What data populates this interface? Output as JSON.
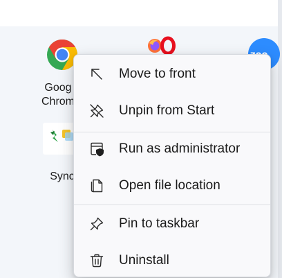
{
  "pinned_apps": {
    "chrome": {
      "label_line1": "Goog",
      "label_line2": "Chrom",
      "icon": "chrome-icon"
    },
    "opera_firefox": {
      "icon": "firefox-opera-icons"
    },
    "zoom": {
      "icon": "zoom-icon",
      "text": "zoo"
    },
    "sync": {
      "label": "Sync",
      "icon": "sync-app-icon"
    }
  },
  "context_menu": {
    "items": [
      {
        "label": "Move to front",
        "icon": "arrow-up-left-icon"
      },
      {
        "label": "Unpin from Start",
        "icon": "unpin-icon"
      },
      {
        "label": "Run as administrator",
        "icon": "shield-window-icon"
      },
      {
        "label": "Open file location",
        "icon": "folder-document-icon"
      },
      {
        "label": "Pin to taskbar",
        "icon": "pin-icon"
      },
      {
        "label": "Uninstall",
        "icon": "trash-icon"
      }
    ]
  },
  "colors": {
    "panel_background": "#f3f6fa",
    "menu_background": "#f9f9fb",
    "text": "#1a1a1a",
    "chrome_red": "#ea4335",
    "chrome_yellow": "#fbbc05",
    "chrome_green": "#34a853",
    "chrome_blue": "#4285f4",
    "opera_red": "#e8101f",
    "zoom_blue": "#2d8cff"
  }
}
